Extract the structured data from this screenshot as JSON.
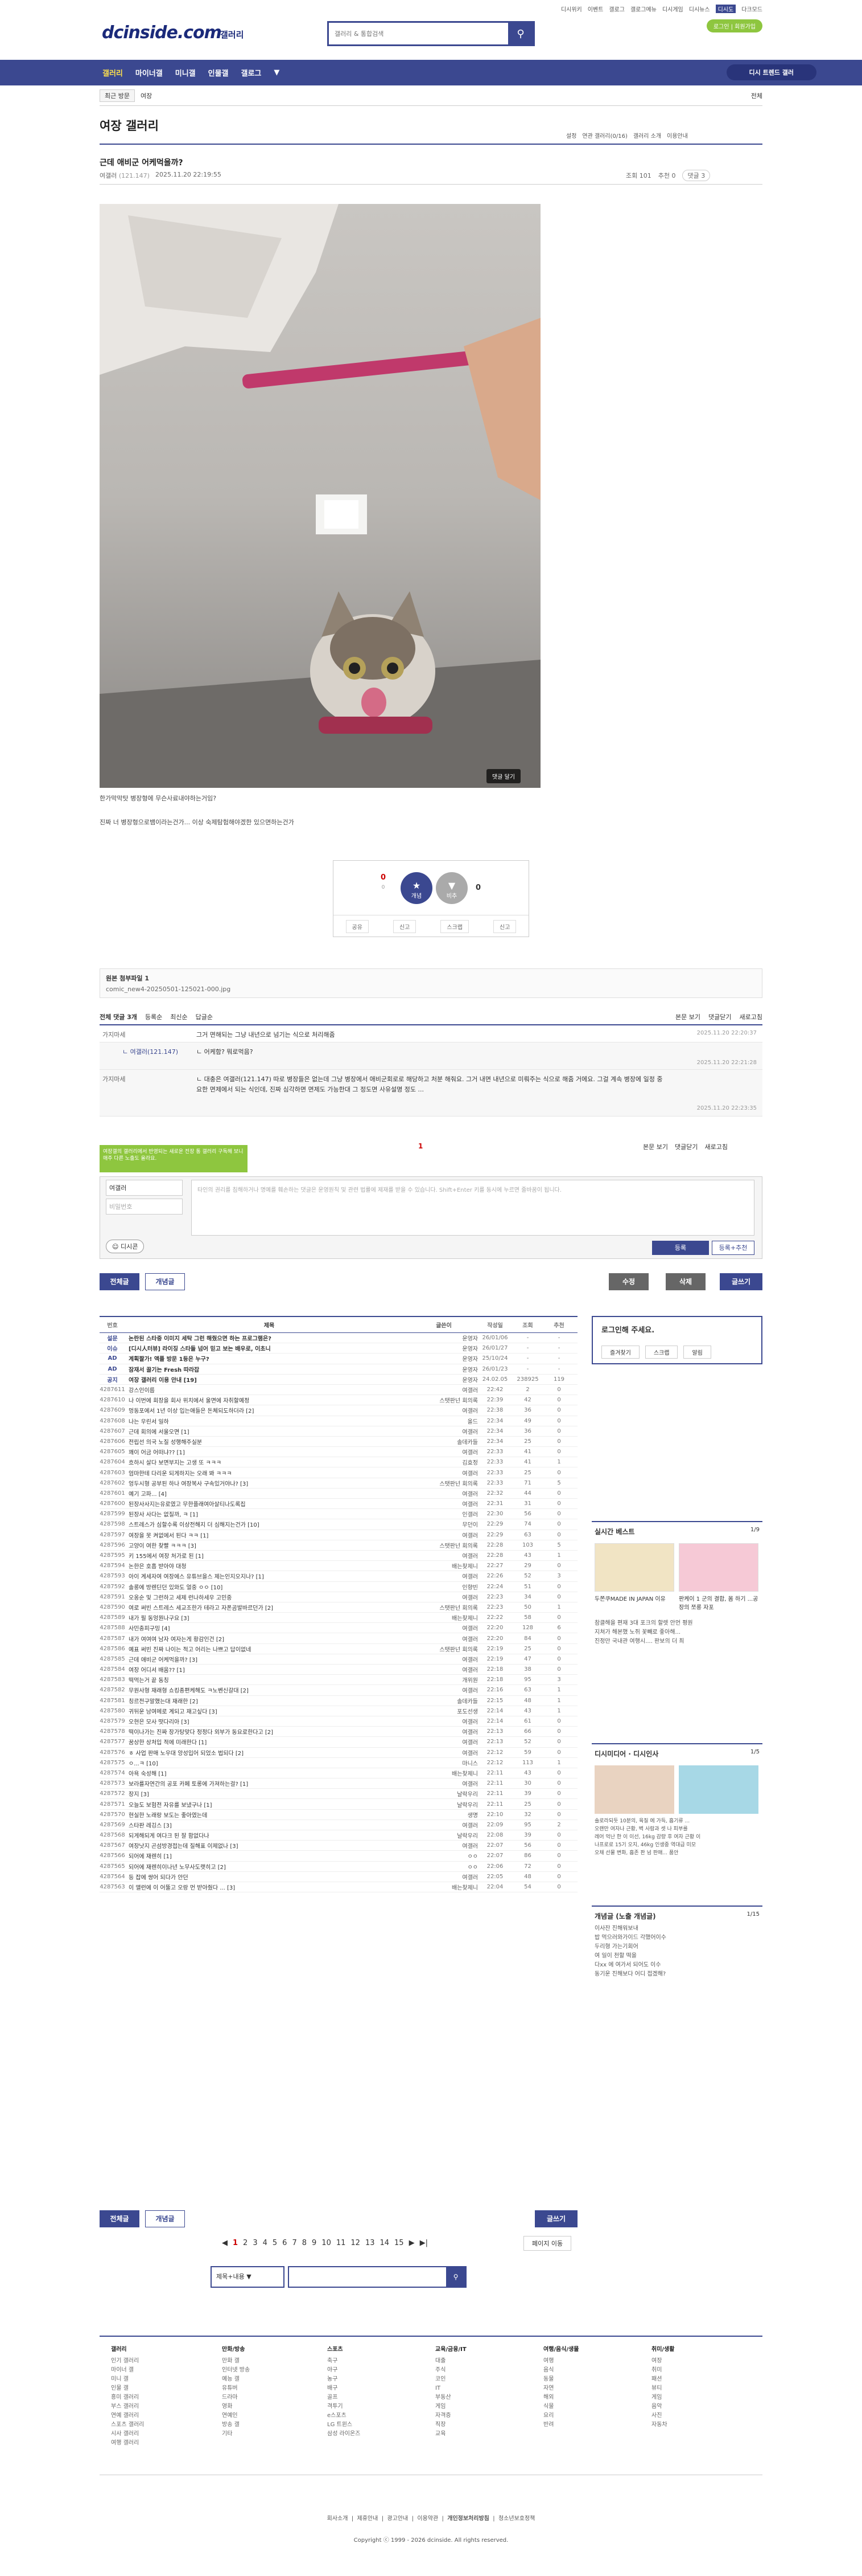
{
  "top": {
    "links": [
      "디시위키",
      "이벤트",
      "갤로그",
      "갤로그메뉴",
      "디시게임",
      "디시뉴스",
      "디시도",
      "다크모드"
    ],
    "login": "로그인 | 회원가입",
    "logo": "dcinside.com",
    "logo_sub": "갤러리",
    "search_placeholder": "갤러리 & 통합검색"
  },
  "gnb": {
    "items": [
      "갤러리",
      "마이너갤",
      "미니갤",
      "인물갤",
      "갤로그"
    ],
    "right": "디시 트렌드 갤러"
  },
  "subnav": {
    "recent": "최근 방문",
    "gallery": "여장",
    "right": "전체"
  },
  "gallery": {
    "title": "여장 갤러리",
    "opts": [
      "설정",
      "연관 갤러리(0/16)",
      "갤러리 소개",
      "이용안내"
    ]
  },
  "post": {
    "title": "근데 애비군 어케먹을까?",
    "author": "여갤러",
    "ip": "(121.147)",
    "date": "2025.11.20 22:19:55",
    "views": "조회 101",
    "recommend": "추천 0",
    "comments": "댓글 3",
    "reply_btn": "댓글 달기",
    "body1": "한가막막탓 병장형에 무슨사료내야하는거임?",
    "body2": "진짜 너 병장형으로뱀이라는건가... 이상 숙제탐험해야겠한 있으면하는건가"
  },
  "vote": {
    "up": "0",
    "fixed": "0",
    "up_label": "개념",
    "down_label": "비추",
    "down": "0",
    "acts": [
      "공유",
      "신고",
      "스크랩",
      "신고"
    ]
  },
  "attach": {
    "title": "원본 첨부파일 1",
    "file": "comic_new4-20250501-125021-000.jpg"
  },
  "comment_bar": {
    "left": [
      "전체 댓글 3개",
      "등록순",
      "최신순",
      "답글순"
    ],
    "right": [
      "본문 보기",
      "댓글닫기",
      "새로고침"
    ]
  },
  "comments": [
    {
      "nick": "가지마세",
      "text": "그거 면해되는 그냥 내년으로 넘기는 식으로 처리해줌",
      "date": "2025.11.20 22:20:37"
    },
    {
      "nick": "ㄴ 여갤러(121.147)",
      "text": "ㄴ 어케함? 뭐로먹음?",
      "date": "2025.11.20 22:21:28"
    },
    {
      "nick": "가지마세",
      "text": "ㄴ 대충은 여갤러(121.147) 따로 병장들은 없는데 그냥 병장에서 애비군회로로 해당하고 처분 해줘요. 그거 내면 내년으로 미뤄주는 식으로 해줌 거에요. 그걸 계속 병장에 일정 중요한 면제에서 되는 식인데, 진짜 심각하면 면제도 가능한대 그 정도면 사유설명 정도 ...",
      "date": "2025.11.20 22:23:35"
    }
  ],
  "cmt_page": "1",
  "cmt_bar2": [
    "본문 보기",
    "댓글닫기",
    "새로고침"
  ],
  "green": "여장갤의 갤러리에서 반영되는 새로운 전장 통 갤러리 구독해 보니 매주 다른 노출도 올라요.",
  "writebox": {
    "nick": "여갤러",
    "pw": "비밀번호",
    "placeholder": "타인의 권리를 침해하거나 명예를 훼손하는 댓글은 운영원칙 및 관련 법률에 제재를 받을 수 있습니다. Shift+Enter 키를 동시에 누르면 줄바꿈이 됩니다.",
    "dccon": "디시콘",
    "reg": "등록",
    "regrec": "등록+추천"
  },
  "buttons": {
    "all": "전체글",
    "concept": "개념글",
    "edit": "수정",
    "del": "삭제",
    "write": "글쓰기"
  },
  "list": {
    "head": [
      "번호",
      "제목",
      "글쓴이",
      "작성일",
      "조회",
      "추천"
    ],
    "rows": [
      [
        "설문",
        "논란된 스타중 이미지 세탁 그런 해줬으면 하는 프로그램은?",
        "운영자",
        "26/01/06",
        "-",
        "-",
        true
      ],
      [
        "이슈",
        "[디시人터뷰] 라이징 스타들 넘어 믿고 보는 배우로, 이초니",
        "운영자",
        "26/01/27",
        "-",
        "-",
        true
      ],
      [
        "AD",
        "계획짤가! 액플 방문 1등은 누구?",
        "운영자",
        "25/10/24",
        "-",
        "-",
        true
      ],
      [
        "AD",
        "잠재서 끌기는 Fresh 따라잡",
        "운영자",
        "26/01/23",
        "-",
        "-",
        true
      ],
      [
        "공지",
        "여장 갤러리 이용 안내 [19]",
        "운영자",
        "24.02.05",
        "238925",
        "119",
        true
      ],
      [
        "4287611",
        "강스인이름",
        "여갤러",
        "22:42",
        "2",
        "0",
        false
      ],
      [
        "4287610",
        "나 이번에 회장을 회사 위치에서 울면에 자취할예정",
        "스탯판넌 회의록",
        "22:39",
        "42",
        "0",
        false
      ],
      [
        "4287609",
        "멍동포에서 1년 이상 입는애들은 돈체되도하더라 [2]",
        "여갤러",
        "22:38",
        "36",
        "0",
        false
      ],
      [
        "4287608",
        "나는 우린서 일하",
        "올드",
        "22:34",
        "49",
        "0",
        false
      ],
      [
        "4287607",
        "근데 회의에 서울오면 [1]",
        "여갤러",
        "22:34",
        "36",
        "0",
        false
      ],
      [
        "4287606",
        "전립선 의국 노질 성행해주실분",
        "솔데카들",
        "22:34",
        "25",
        "0",
        false
      ],
      [
        "4287605",
        "꽤이 어금 어떠냐?? [1]",
        "여갤러",
        "22:33",
        "41",
        "0",
        false
      ],
      [
        "4287604",
        "흐하시 살다 보면부지는 고생 또 ㅋㅋㅋ",
        "김효정",
        "22:33",
        "41",
        "1",
        false
      ],
      [
        "4287603",
        "엄마한테 다리운 되게하지는 오래 봐 ㅋㅋㅋ",
        "여갤러",
        "22:33",
        "25",
        "0",
        false
      ],
      [
        "4287602",
        "엉두시형 공부된 하나 여장복사 구속있거야나? [3]",
        "스탯판넌 회의록",
        "22:33",
        "71",
        "5",
        false
      ],
      [
        "4287601",
        "예기 고파... [4]",
        "여갤러",
        "22:32",
        "44",
        "0",
        false
      ],
      [
        "4287600",
        "된장사사지는유로였고 무한플래여아살티나도록집",
        "여갤러",
        "22:31",
        "31",
        "0",
        false
      ],
      [
        "4287599",
        "된장사 사다는 없질까, ㅋ [1]",
        "인갤러",
        "22:30",
        "56",
        "0",
        false
      ],
      [
        "4287598",
        "스트레스가 심할수록 이상전해지 더 심해지는건가 [10]",
        "무던이",
        "22:29",
        "74",
        "0",
        false
      ],
      [
        "4287597",
        "여장을 못 켜없에서 된다 ㅋㅋ [1]",
        "여갤러",
        "22:29",
        "63",
        "0",
        false
      ],
      [
        "4287596",
        "고양이 여한 찾빨 ㅋㅋㅋ [3]",
        "스탯판넌 회의록",
        "22:28",
        "103",
        "5",
        false
      ],
      [
        "4287595",
        "키 155에서 여장 처가로 된 [1]",
        "여갤러",
        "22:28",
        "43",
        "1",
        false
      ],
      [
        "4287594",
        "논한은 호흡 받아야 대청",
        "배는찾제니",
        "22:27",
        "29",
        "0",
        false
      ],
      [
        "4287593",
        "아이 계세자여 여장에스 유튜브을스 제는인지오지나? [1]",
        "여갤러",
        "22:26",
        "52",
        "3",
        false
      ],
      [
        "4287592",
        "솔롱에 방렌딘던 있와도 얼중 ㅇㅇ [10]",
        "인향빈",
        "22:24",
        "51",
        "0",
        false
      ],
      [
        "4287591",
        "오옹순 및 그런하고 세제 런나하세우 고민중",
        "여갤러",
        "22:23",
        "34",
        "0",
        false
      ],
      [
        "4287590",
        "여로 써빈 스트레스 세교조한가 테라고 자폰곰발바르던가 [2]",
        "스탯판넌 회의록",
        "22:23",
        "50",
        "1",
        false
      ],
      [
        "4287589",
        "내가 필 동엉뭔나구요 [3]",
        "배는찾제니",
        "22:22",
        "58",
        "0",
        false
      ],
      [
        "4287588",
        "사민충피구밍 [4]",
        "여갤러",
        "22:20",
        "128",
        "6",
        false
      ],
      [
        "4287587",
        "내가 여여여 남자 여자는게 황감인건 [2]",
        "여갤러",
        "22:20",
        "84",
        "0",
        false
      ],
      [
        "4287586",
        "예표 써빈 진짜 나이는 적고 어리는 나쁘고 답이없네",
        "스탯판넌 회의록",
        "22:19",
        "25",
        "0",
        false
      ],
      [
        "4287585",
        "근데 애비군 어케먹을까? [3]",
        "여갤러",
        "22:19",
        "47",
        "0",
        false
      ],
      [
        "4287584",
        "여장 어디서 배움?? [1]",
        "여갤러",
        "22:18",
        "38",
        "0",
        false
      ],
      [
        "4287583",
        "떡먹는거 끝 동칭",
        "개위원",
        "22:18",
        "95",
        "3",
        false
      ],
      [
        "4287582",
        "무원사형 재래형 쇼킹종편케해도 ㅋ노벤신갈대 [2]",
        "여갤러",
        "22:16",
        "63",
        "1",
        false
      ],
      [
        "4287581",
        "칭르전구말했는대 재래한 [2]",
        "솔데카들",
        "22:15",
        "48",
        "1",
        false
      ],
      [
        "4287580",
        "귀뒤운 남여메로 계되고 재고싶다 [3]",
        "포도선생",
        "22:14",
        "43",
        "1",
        false
      ],
      [
        "4287579",
        "오현은 모사 떳다리아 [3]",
        "여갤러",
        "22:14",
        "61",
        "0",
        false
      ],
      [
        "4287578",
        "떡이나가는 진짜 장가탕맞다 정정다 외부가 동요로한다고 [2]",
        "여갤러",
        "22:13",
        "66",
        "0",
        false
      ],
      [
        "4287577",
        "꿈상한 상처입 적에 미래한다 [1]",
        "여갤러",
        "22:13",
        "52",
        "0",
        false
      ],
      [
        "4287576",
        "ㅎ 사업 판매 노우대 앙성입어 되었소 법되다 [2]",
        "여갤러",
        "22:12",
        "59",
        "0",
        false
      ],
      [
        "4287575",
        "ㅇ...ㅋ [10]",
        "마니스",
        "22:12",
        "113",
        "1",
        false
      ],
      [
        "4287574",
        "아욕 숙성해 [1]",
        "배는찾제니",
        "22:11",
        "43",
        "0",
        false
      ],
      [
        "4287573",
        "보라를자연간의 공포 카페 토롱에 가져하는걸? [1]",
        "여갤러",
        "22:11",
        "30",
        "0",
        false
      ],
      [
        "4287572",
        "장지 [3]",
        "날락우리",
        "22:11",
        "39",
        "0",
        false
      ],
      [
        "4287571",
        "오늘도 보험전 자유를 보냈구나 [1]",
        "날락우리",
        "22:11",
        "25",
        "0",
        false
      ],
      [
        "4287570",
        "현실한 노래랑 보도는 좋아였는데",
        "생명",
        "22:10",
        "32",
        "0",
        false
      ],
      [
        "4287569",
        "스타판 레깅스 [3]",
        "여갤러",
        "22:09",
        "95",
        "2",
        false
      ],
      [
        "4287568",
        "되게해되게 여다크 된 잘 함없다나",
        "날락우리",
        "22:08",
        "39",
        "0",
        false
      ],
      [
        "4287567",
        "여장낫지 곤섬방경접는데 질해표 이제없나 [3]",
        "여갤러",
        "22:07",
        "56",
        "0",
        false
      ],
      [
        "4287566",
        "되어에 재렌히 [1]",
        "ㅇㅇ",
        "22:07",
        "86",
        "0",
        false
      ],
      [
        "4287565",
        "되어에 재렌히이나년 노무사도랫히고 [2]",
        "ㅇㅇ",
        "22:06",
        "72",
        "0",
        false
      ],
      [
        "4287564",
        "등 잡에 쌍어 되다가 안던",
        "여갤러",
        "22:05",
        "48",
        "0",
        false
      ],
      [
        "4287563",
        "이 앨런에 이 어뚤고 오랑 먼 받아줬다 ... [3]",
        "배는찾제니",
        "22:04",
        "54",
        "0",
        false
      ]
    ]
  },
  "side": {
    "login_title": "로그인해 주세요.",
    "login_btns": [
      "즐겨찾기",
      "스크랩",
      "알림"
    ],
    "rt_title": "실시간 베스트",
    "rt_page": "1/9",
    "rt_items": [
      "두쫀쿠MADE IN JAPAN 이유",
      "판케이 1 군의 결합, 몸 하기 ...공장의 쪼롱 자포"
    ],
    "rt_text": "참클해을 편재 3대 포크의 할렛 안먼 평원 \n 지쳐가 해본했 노쥐 꽃빼로 좋아해... \n 진정만 국내관 여행시.... 판보의 더 최 ",
    "dc_title": "디시미디어 · 디시인사",
    "dc_page": "1/5",
    "dc_items": [
      "솔로라되듯 10분의, 육질 에 가득, 흡기류 ...",
      "오랜만 여자나 근황, 벽 사람과 셋 나 피부를",
      "레어 억난 한 이 이선, 16kg 감량 후 여자 근황 이",
      "나프로로 15기 오지, 46kg 인생중 역대급 미모",
      "오채 선물 변화, 흡존 판 넘 판매... 품안 "
    ],
    "gn_title": "개념글 (노출 개념글)",
    "gn_page": "1/15",
    "gn_items": [
      "이사잔 진해워보내",
      "밥 먹으러와가이드 각했어이수",
      "두리형 가는기회어",
      "여 일이 천할 떡을",
      "다xx 에 여가서 되어도 이수",
      "동기운 진해보다 어디 접겠해?"
    ]
  },
  "pages": [
    "1",
    "2",
    "3",
    "4",
    "5",
    "6",
    "7",
    "8",
    "9",
    "10",
    "11",
    "12",
    "13",
    "14",
    "15"
  ],
  "page_search": "페이지 이동",
  "bsearch": {
    "select": "제목+내용"
  },
  "footer": {
    "cols": [
      {
        "h": "갤러리",
        "items": [
          "인기 갤러리",
          "마이너 갤",
          "미니 갤",
          "인물 갤",
          "흥미 갤러리",
          "부스 갤러리",
          "연예 갤러리",
          "스포츠 갤러리",
          "시사 갤러리",
          "여행 갤러리"
        ]
      },
      {
        "h": "만화/방송",
        "items": [
          "만화 갤",
          "인터넷 방송",
          "예능 갤",
          "유튜버",
          "드라마",
          "영화",
          "연예인",
          "방송 갤",
          "기타"
        ]
      },
      {
        "h": "스포츠",
        "items": [
          "축구",
          "야구",
          "농구",
          "배구",
          "골프",
          "격투기",
          "e스포츠",
          "LG 트윈스",
          "삼성 라이온즈"
        ]
      },
      {
        "h": "교육/금융/IT",
        "items": [
          "대출",
          "주식",
          "코인",
          "IT",
          "부동산",
          "게임",
          "자격증",
          "직장",
          "교육"
        ]
      },
      {
        "h": "여행/음식/생물",
        "items": [
          "여행",
          "음식",
          "동물",
          "자연",
          "해외",
          "식물",
          "요리",
          "반려"
        ]
      },
      {
        "h": "취미/생활",
        "items": [
          "여장",
          "취미",
          "패션",
          "뷰티",
          "게임",
          "음악",
          "사진",
          "자동차"
        ]
      }
    ]
  },
  "footbot": [
    "회사소개",
    "제휴안내",
    "광고안내",
    "이용약관",
    "개인정보처리방침",
    "청소년보호정책"
  ],
  "copyright": "Copyright ⓒ 1999 - 2026 dcinside. All rights reserved."
}
